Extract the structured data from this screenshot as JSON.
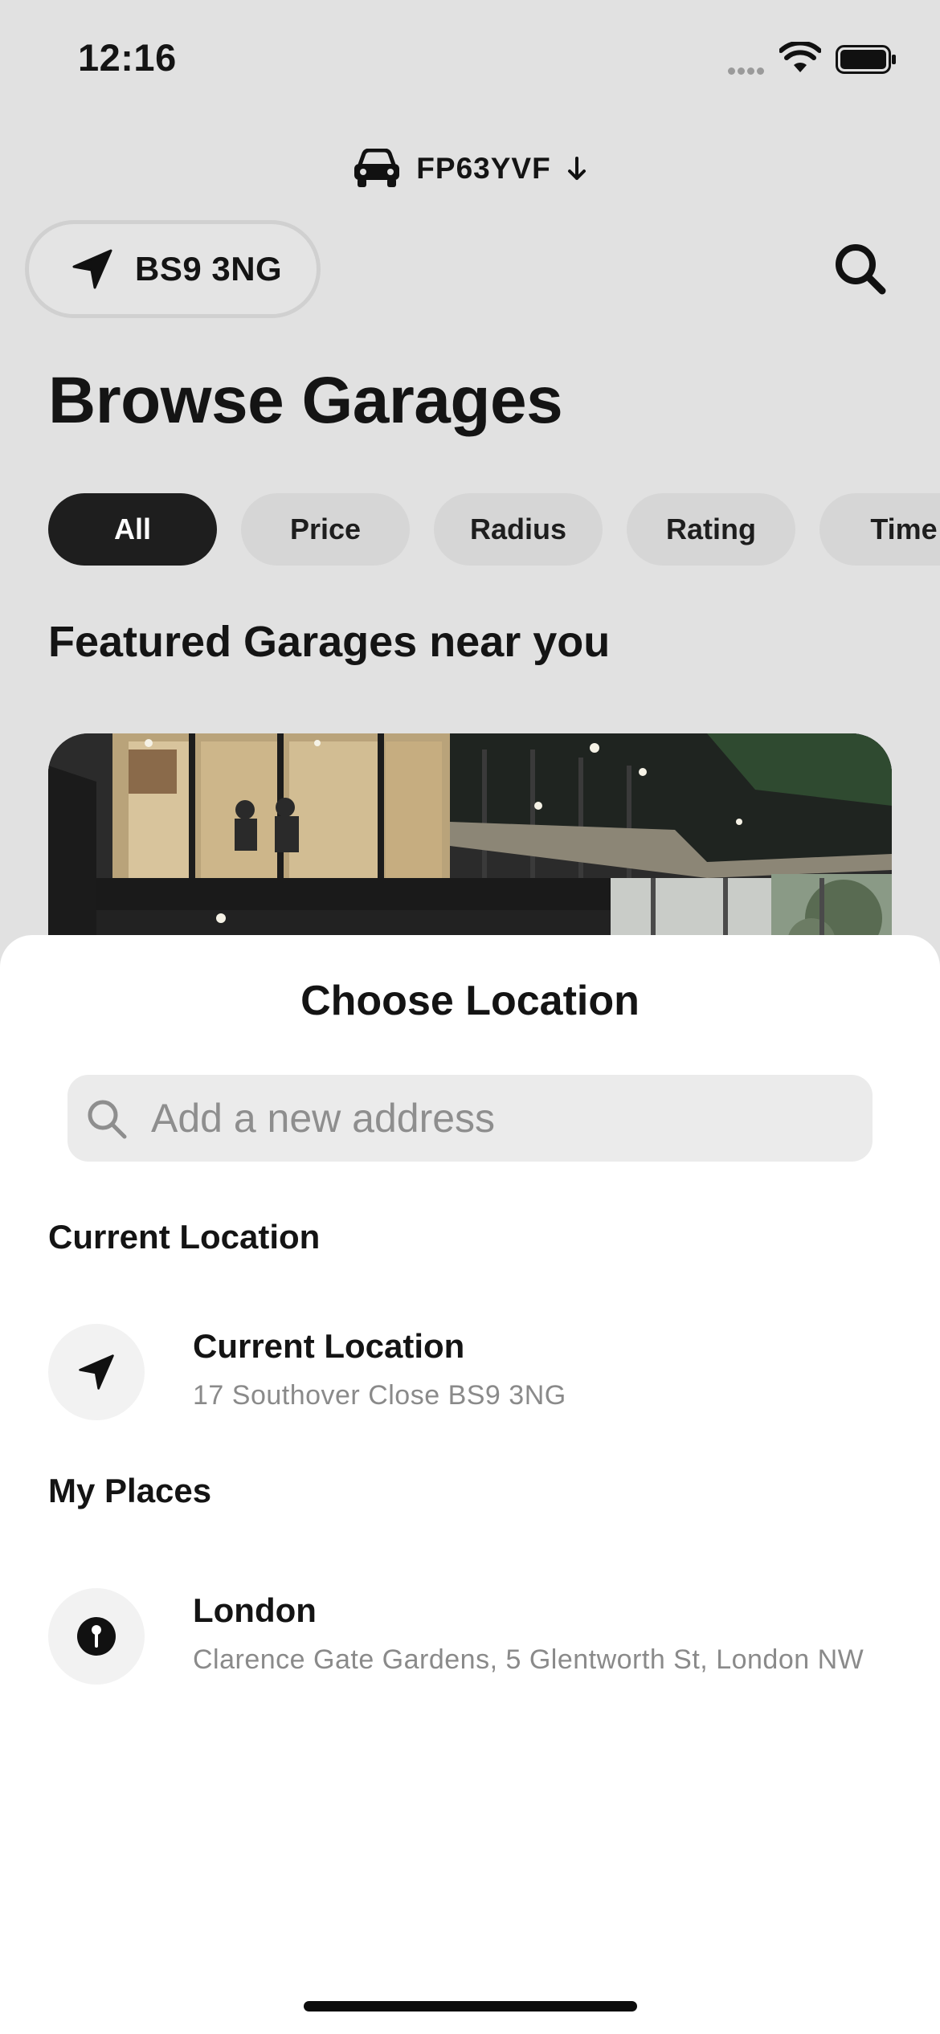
{
  "status_bar": {
    "time": "12:16",
    "icons": [
      "signal-icon",
      "wifi-icon",
      "battery-icon"
    ]
  },
  "vehicle": {
    "icon": "car-icon",
    "plate": "FP63YVF",
    "dropdown_icon": "arrow-down-icon"
  },
  "location_pill": {
    "icon": "navigation-arrow-icon",
    "label": "BS9 3NG"
  },
  "header": {
    "search_icon": "search-icon"
  },
  "page_title": "Browse Garages",
  "filters": [
    "All",
    "Price",
    "Radius",
    "Rating",
    "Time"
  ],
  "active_filter": "All",
  "featured": {
    "title": "Featured Garages near you"
  },
  "sheet": {
    "title": "Choose Location",
    "search_placeholder": "Add a new address",
    "current_section_title": "Current Location",
    "current": {
      "icon": "navigation-arrow-icon",
      "name": "Current Location",
      "address": "17 Southover Close BS9 3NG"
    },
    "places_section_title": "My Places",
    "places": [
      {
        "icon": "pin-icon",
        "name": "London",
        "address": "Clarence Gate Gardens, 5 Glentworth St, London NW"
      }
    ]
  },
  "colors": {
    "background": "#e1e1e1",
    "sheet": "#ffffff",
    "chip_active": "#1e1e1e",
    "chip": "#d6d6d6",
    "muted_text": "#8a8a8a"
  }
}
